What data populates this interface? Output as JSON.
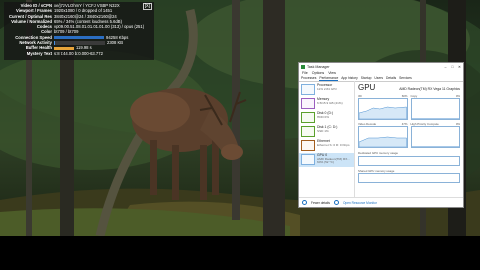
{
  "stats": {
    "rows": [
      {
        "key": "Video ID / sCPN",
        "val": "xe/j7zVLOhmY / YCFJ VSBP N32X"
      },
      {
        "key": "Viewport / Frames",
        "val": "1920x1080 / 0 dropped of 1451"
      },
      {
        "key": "Current / Optimal Res",
        "val": "3840x2160@24 / 3840x2160@24"
      },
      {
        "key": "Volume / Normalized",
        "val": "65% / 34% (content loudness 5.6dB)"
      },
      {
        "key": "Codecs",
        "val": "vp09.00.51.08.01.01.01.01.00 (313) / opus (251)"
      },
      {
        "key": "Color",
        "val": "bt709 / bt709"
      },
      {
        "key": "Connection Speed",
        "val": "94258 Kbps"
      },
      {
        "key": "Network Activity",
        "val": "2308 KB"
      },
      {
        "key": "Buffer Health",
        "val": "119.98 s"
      },
      {
        "key": "Mystery Text",
        "val": "s:8 t:44.00 b:0.000-63.772"
      }
    ],
    "close_label": "[x]"
  },
  "task_manager": {
    "title": "Task Manager",
    "controls": [
      "–",
      "□",
      "✕"
    ],
    "menu": [
      "File",
      "Options",
      "View"
    ],
    "tabs": [
      "Processes",
      "Performance",
      "App history",
      "Startup",
      "Users",
      "Details",
      "Services"
    ],
    "active_tab": "Performance",
    "sidebar": [
      {
        "title": "Processor",
        "sub": "11% 2.84 GHz"
      },
      {
        "title": "Memory",
        "sub": "6.5/15.9 GB (41%)"
      },
      {
        "title": "Disk 0 (D:)",
        "sub": "HDD 0%"
      },
      {
        "title": "Disk 1 (C: D:)",
        "sub": "SSD 1%"
      },
      {
        "title": "Ethernet",
        "sub": "Ethernet S: 0 R: 0 Kbps"
      },
      {
        "title": "GPU 0",
        "sub": "AMD Radeon(TM) RX... 60% (52 °C)"
      }
    ],
    "gpu_title": "GPU",
    "gpu_name": "AMD Radeon(TM) RX Vega 11 Graphics",
    "graphs": [
      {
        "label": "3D",
        "pct": "60%"
      },
      {
        "label": "Copy",
        "pct": "0%"
      },
      {
        "label": "Video Decode",
        "pct": "47%"
      },
      {
        "label": "High Priority Compute",
        "pct": "0%"
      }
    ],
    "mem_labels": [
      "Dedicated GPU memory usage",
      "Shared GPU memory usage"
    ],
    "footer": {
      "fewer": "Fewer details",
      "monitor": "Open Resource Monitor"
    }
  }
}
